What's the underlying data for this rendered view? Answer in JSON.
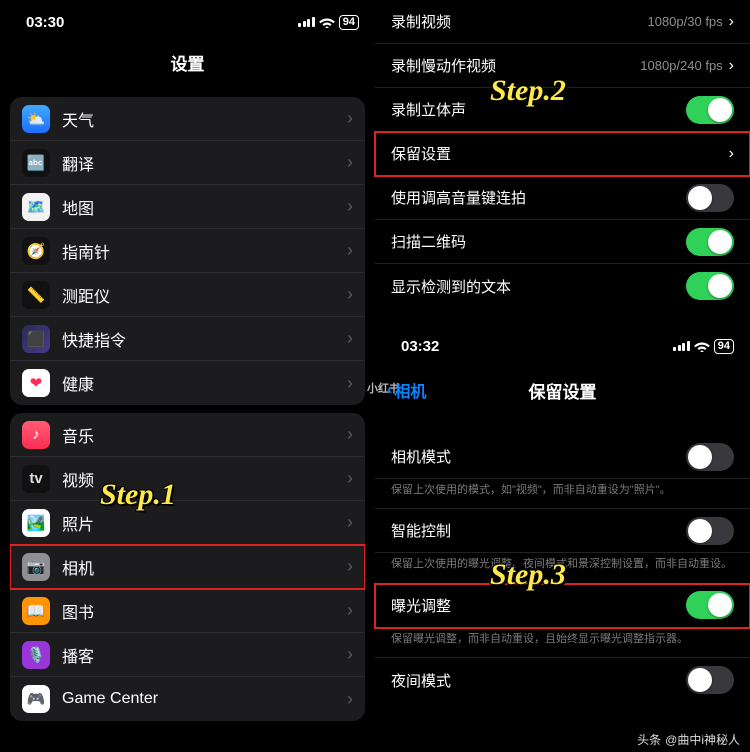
{
  "annotations": {
    "step1": "Step.1",
    "step2": "Step.2",
    "step3": "Step.3"
  },
  "credit": {
    "prefix": "头条",
    "name": "@曲中i神秘人"
  },
  "left": {
    "status": {
      "time": "03:30",
      "battery": "94"
    },
    "title": "设置",
    "group1": [
      {
        "icon": "weather",
        "label": "天气"
      },
      {
        "icon": "translate",
        "label": "翻译"
      },
      {
        "icon": "maps",
        "label": "地图"
      },
      {
        "icon": "compass",
        "label": "指南针"
      },
      {
        "icon": "measure",
        "label": "测距仪"
      },
      {
        "icon": "shortcuts",
        "label": "快捷指令"
      },
      {
        "icon": "health",
        "label": "健康"
      }
    ],
    "group2": [
      {
        "icon": "music",
        "label": "音乐"
      },
      {
        "icon": "tv",
        "label": "视频"
      },
      {
        "icon": "photos",
        "label": "照片"
      },
      {
        "icon": "camera",
        "label": "相机",
        "highlight": true
      },
      {
        "icon": "books",
        "label": "图书"
      },
      {
        "icon": "podcasts",
        "label": "播客"
      },
      {
        "icon": "gc",
        "label": "Game Center"
      }
    ]
  },
  "right_top": {
    "rows": [
      {
        "label": "录制视频",
        "value": "1080p/30 fps",
        "type": "link"
      },
      {
        "label": "录制慢动作视频",
        "value": "1080p/240 fps",
        "type": "link"
      },
      {
        "label": "录制立体声",
        "type": "toggle",
        "on": true
      },
      {
        "label": "保留设置",
        "type": "link",
        "highlight": true
      },
      {
        "label": "使用调高音量键连拍",
        "type": "toggle",
        "on": false
      },
      {
        "label": "扫描二维码",
        "type": "toggle",
        "on": true
      },
      {
        "label": "显示检测到的文本",
        "type": "toggle",
        "on": true
      }
    ]
  },
  "right_bottom": {
    "status": {
      "time": "03:32",
      "battery": "94"
    },
    "watermark": "小红书",
    "back": "相机",
    "title": "保留设置",
    "rows": [
      {
        "label": "相机模式",
        "type": "toggle",
        "on": false,
        "sub": "保留上次使用的模式，如\"视频\"，而非自动重设为\"照片\"。"
      },
      {
        "label": "智能控制",
        "type": "toggle",
        "on": false,
        "sub": "保留上次使用的曝光调整、夜间模式和景深控制设置，而非自动重设。"
      },
      {
        "label": "曝光调整",
        "type": "toggle",
        "on": true,
        "highlight": true,
        "sub": "保留曝光调整，而非自动重设，且始终显示曝光调整指示器。"
      },
      {
        "label": "夜间模式",
        "type": "toggle",
        "on": false
      }
    ]
  }
}
